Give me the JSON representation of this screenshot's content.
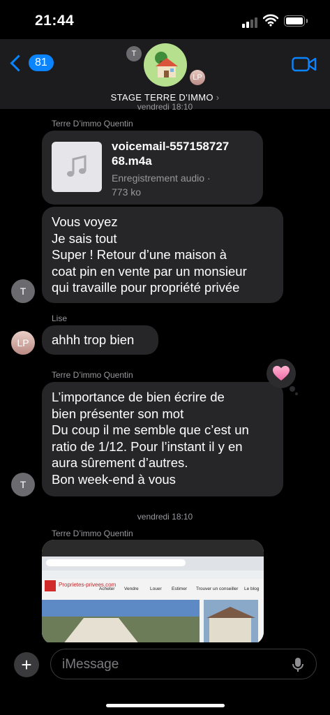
{
  "status_bar": {
    "time": "21:44"
  },
  "header": {
    "back_count": "81",
    "group_name": "STAGE TERRE D’IMMO",
    "member_initials": [
      "T",
      "LP"
    ]
  },
  "timestamp_top": "vendredi 18:10",
  "messages": [
    {
      "sender": "Terre D’immo Quentin",
      "type": "attachment",
      "file_name_lines": [
        "voicemail-557158727",
        "68.m4a"
      ],
      "file_type_lines": [
        "Enregistrement audio ·",
        "773 ko"
      ]
    },
    {
      "type": "text",
      "avatar": "T",
      "lines": [
        "Vous voyez",
        "Je sais tout",
        "Super ! Retour d’une maison à",
        "coat pin en vente par un monsieur",
        "qui travaille pour propriété privée"
      ]
    },
    {
      "sender": "Lise",
      "type": "text",
      "avatar": "LP",
      "lines": [
        "ahhh trop bien"
      ]
    },
    {
      "sender": "Terre D’immo Quentin",
      "type": "text",
      "avatar": "T",
      "reaction": "heart-reaction",
      "lines": [
        "L’importance de bien écrire de",
        "bien présenter son mot",
        "Du coup il me semble que c’est un",
        "ratio de 1/12. Pour l’instant il y en",
        "aura sûrement d’autres.",
        "Bon week-end à vous"
      ]
    }
  ],
  "timestamp_bottom": "vendredi 18:10",
  "image_message": {
    "sender": "Terre D’immo Quentin",
    "site_nav": [
      "Acheter",
      "Vendre",
      "Louer",
      "Estimer",
      "Trouver un conseiller",
      "Le blog"
    ],
    "site_logo": "Proprietes-privees.com"
  },
  "input": {
    "placeholder": "iMessage"
  },
  "colors": {
    "accent": "#0a84ff",
    "bubble": "#262628",
    "background": "#000000"
  }
}
